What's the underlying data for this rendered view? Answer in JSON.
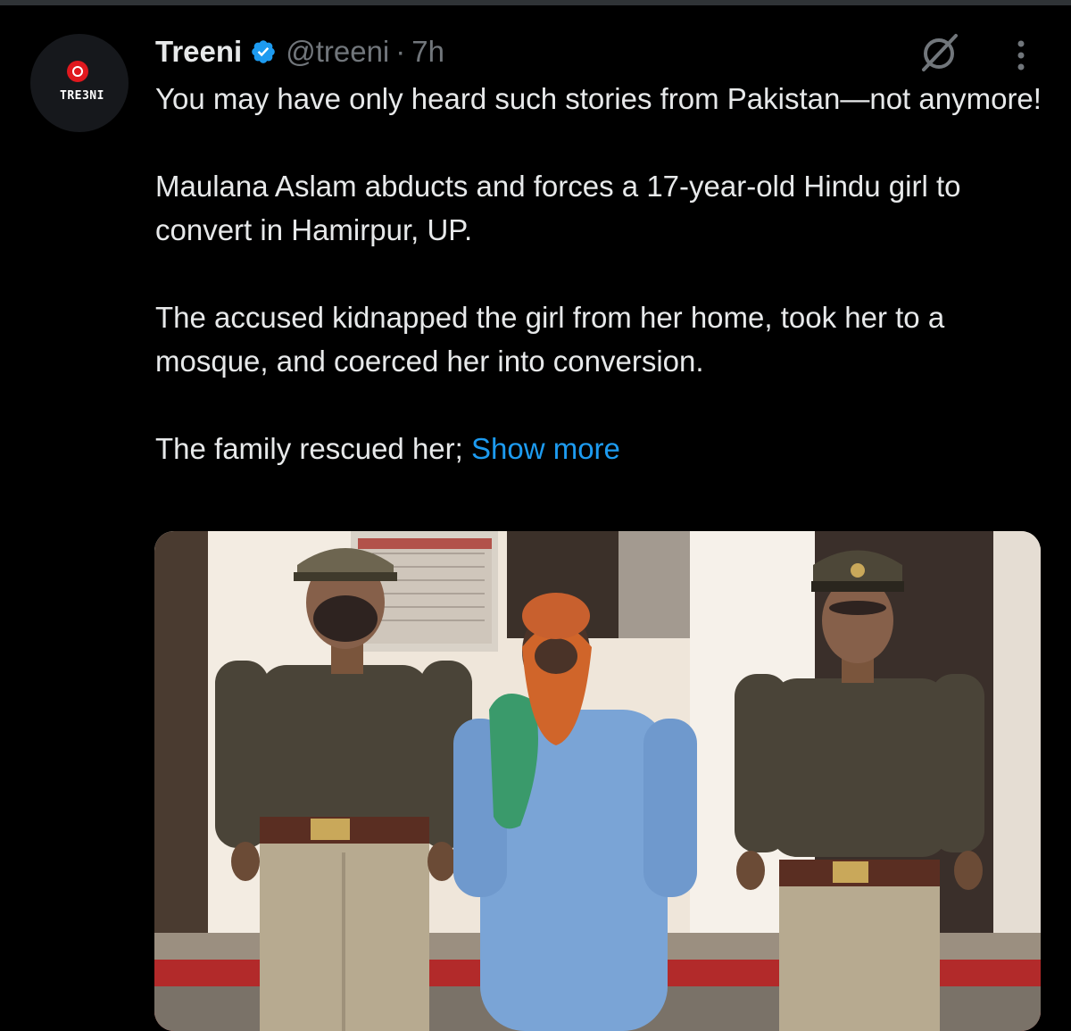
{
  "tweet": {
    "author": {
      "display_name": "Treeni",
      "handle": "@treeni",
      "verified_icon": "verified-badge-icon",
      "avatar_text": "TRE3NI"
    },
    "separator": "·",
    "timestamp": "7h",
    "paragraphs": [
      "You may have only heard such stories from Pakistan—not anymore!",
      "Maulana Aslam abducts and forces a 17-year-old Hindu girl to convert in Hamirpur, UP.",
      "The accused kidnapped the girl from her home, took her to a mosque, and coerced her into conversion."
    ],
    "last_paragraph_text": "The family rescued her;",
    "show_more_label": "Show more",
    "media_icon_name": "photo-of-three-men",
    "actions": {
      "grok_icon": "grok-icon",
      "more_icon": "more-vertical-icon"
    }
  },
  "colors": {
    "background": "#000000",
    "text": "#e7e9ea",
    "secondary_text": "#71767b",
    "link": "#1d9bf0",
    "verified": "#1d9bf0"
  }
}
